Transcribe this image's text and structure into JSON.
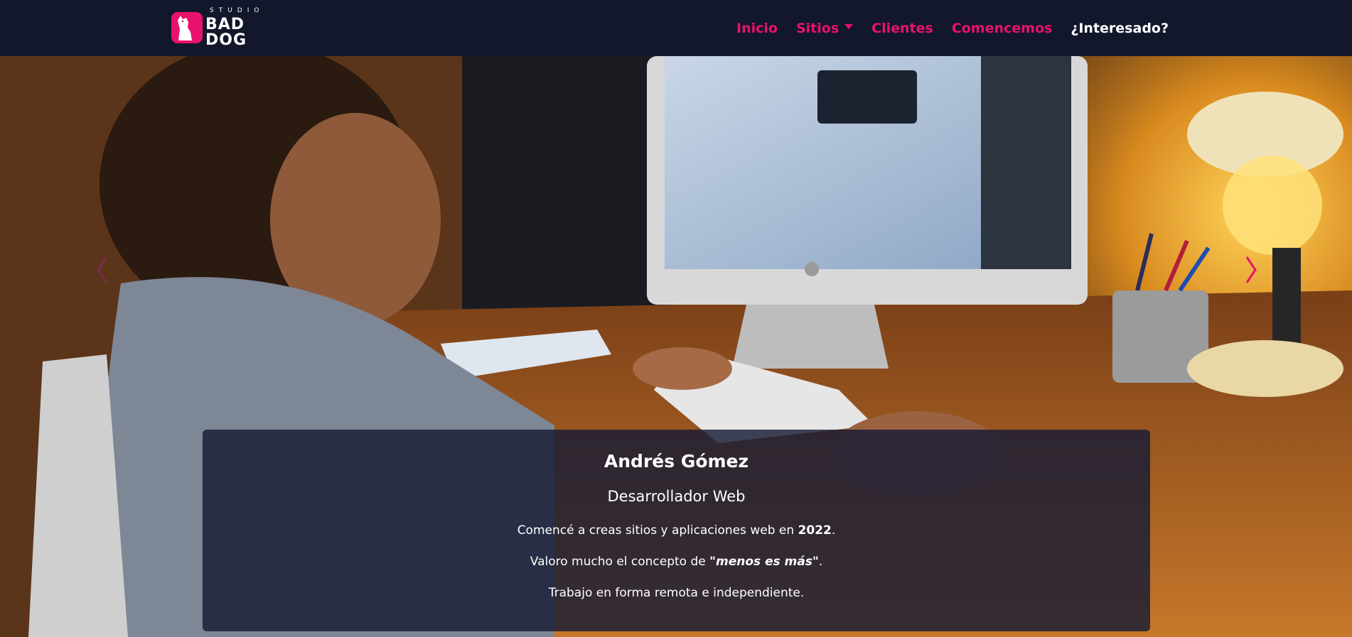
{
  "brand": {
    "small": "STUDIO",
    "big": "BAD DOG",
    "accent": "#e8126b"
  },
  "nav": {
    "items": [
      {
        "label": "Inicio"
      },
      {
        "label": "Sitios",
        "dropdown": true
      },
      {
        "label": "Clientes"
      },
      {
        "label": "Comencemos"
      },
      {
        "label": "¿Interesado?"
      }
    ]
  },
  "caption": {
    "name": "Andrés Gómez",
    "role": "Desarrollador Web",
    "line1_pre": "Comencé a creas sitios y aplicaciones web en ",
    "line1_bold": "2022",
    "line1_post": ".",
    "line2_pre": "Valoro mucho el concepto de ",
    "line2_em": "\"menos es más\"",
    "line2_post": ".",
    "line3": "Trabajo en forma remota e independiente."
  },
  "carousel": {
    "prev_icon": "chevron-left-icon",
    "next_icon": "chevron-right-icon"
  },
  "colors": {
    "navbar": "#12172b",
    "accent": "#e8126b",
    "caption_bg": "#161b34"
  }
}
